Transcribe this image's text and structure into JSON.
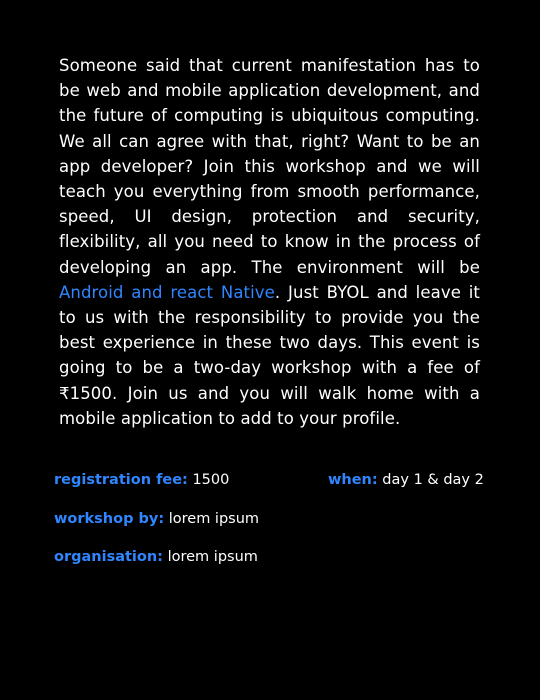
{
  "description": {
    "part1": "Someone said that current manifestation has to be web and mobile application development, and the future of computing is ubiquitous computing. We all can agree with that, right?  Want to be an app developer? Join this workshop and we will teach you everything from smooth performance, speed, UI design, protection and security, flexibility, all you need to know in the process of developing an app. The environment will be ",
    "highlight": "Android and react Native",
    "part2": ". Just BYOL and leave it to us with the responsibility to provide you the best experience in these two days. This event is going to be a two-day workshop with a fee of ₹1500. Join us and you will walk home with a mobile application to add to your profile."
  },
  "details": {
    "registration_fee": {
      "label": "registration fee:",
      "value": "1500"
    },
    "when": {
      "label": "when:",
      "value": "day 1 & day 2"
    },
    "workshop_by": {
      "label": "workshop by:",
      "value": "lorem ipsum"
    },
    "organisation": {
      "label": "organisation:",
      "value": "lorem ipsum"
    }
  },
  "colors": {
    "background": "#000000",
    "text": "#ffffff",
    "accent": "#2f86ff"
  }
}
